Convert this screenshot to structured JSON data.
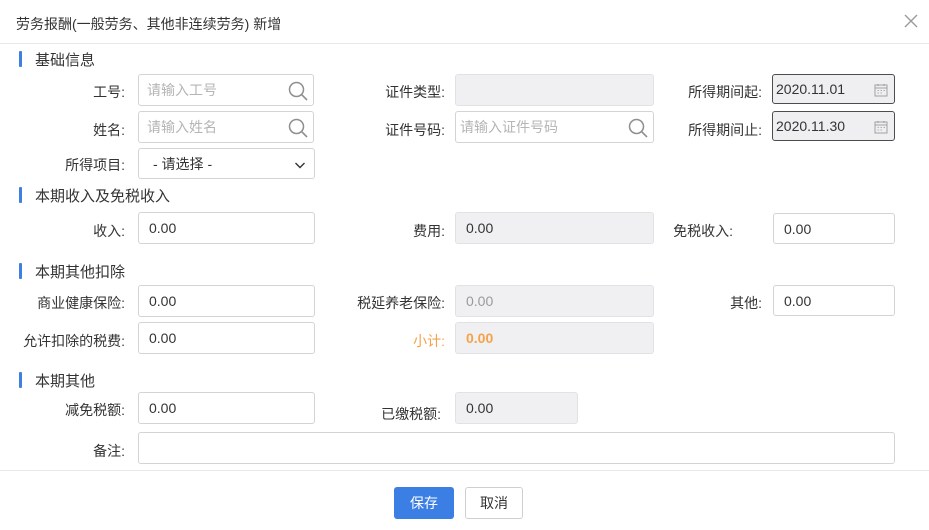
{
  "dialog": {
    "title": "劳务报酬(一般劳务、其他非连续劳务) 新增"
  },
  "sections": {
    "basic": "基础信息",
    "income": "本期收入及免税收入",
    "deduction": "本期其他扣除",
    "other": "本期其他"
  },
  "basic": {
    "employee_no_label": "工号:",
    "employee_no_placeholder": "请输入工号",
    "id_type_label": "证件类型:",
    "period_start_label": "所得期间起:",
    "period_start_value": "2020.11.01",
    "name_label": "姓名:",
    "name_placeholder": "请输入姓名",
    "id_no_label": "证件号码:",
    "id_no_placeholder": "请输入证件号码",
    "period_end_label": "所得期间止:",
    "period_end_value": "2020.11.30",
    "income_item_label": "所得项目:",
    "income_item_selected": "- 请选择 -"
  },
  "income": {
    "income_label": "收入:",
    "income_value": "0.00",
    "expense_label": "费用:",
    "expense_value": "0.00",
    "tax_free_label": "免税收入:",
    "tax_free_value": "0.00"
  },
  "deduction": {
    "health_label": "商业健康保险:",
    "health_value": "0.00",
    "pension_label": "税延养老保险:",
    "pension_value": "0.00",
    "other_label": "其他:",
    "other_value": "0.00",
    "allowed_tax_label": "允许扣除的税费:",
    "allowed_tax_value": "0.00",
    "subtotal_label": "小计:",
    "subtotal_value": "0.00"
  },
  "other": {
    "reduction_label": "减免税额:",
    "reduction_value": "0.00",
    "paid_label": "已缴税额:",
    "paid_value": "0.00",
    "remark_label": "备注:"
  },
  "footer": {
    "save_label": "保存",
    "cancel_label": "取消"
  },
  "colors": {
    "accent": "#3b7fe4",
    "section_bar": "#3e7fe0",
    "subtotal": "#f5a24a"
  }
}
